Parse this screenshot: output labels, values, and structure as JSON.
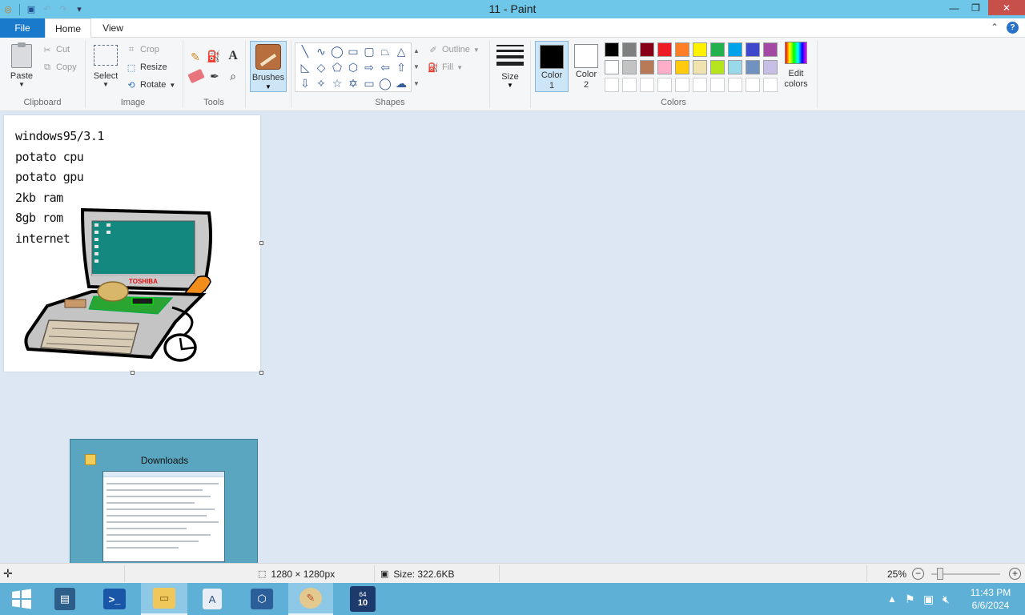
{
  "window": {
    "title": "11 - Paint",
    "controls": {
      "minimize": "—",
      "maximize": "❐",
      "close": "✕"
    }
  },
  "tabs": {
    "file": "File",
    "home": "Home",
    "view": "View"
  },
  "ribbon": {
    "clipboard": {
      "paste": "Paste",
      "cut": "Cut",
      "copy": "Copy",
      "label": "Clipboard"
    },
    "image": {
      "select": "Select",
      "crop": "Crop",
      "resize": "Resize",
      "rotate": "Rotate",
      "label": "Image"
    },
    "tools": {
      "label": "Tools",
      "text_tool": "A"
    },
    "brushes": "Brushes",
    "shapes": {
      "outline": "Outline",
      "fill": "Fill",
      "label": "Shapes"
    },
    "size": "Size",
    "color1": {
      "label_line1": "Color",
      "label_line2": "1",
      "value": "#000000"
    },
    "color2": {
      "label_line1": "Color",
      "label_line2": "2",
      "value": "#ffffff"
    },
    "colors_label": "Colors",
    "edit_colors_line1": "Edit",
    "edit_colors_line2": "colors",
    "palette": [
      "#000000",
      "#7f7f7f",
      "#880015",
      "#ed1c24",
      "#ff7f27",
      "#fff200",
      "#22b14c",
      "#00a2e8",
      "#3f48cc",
      "#a349a4",
      "#ffffff",
      "#c3c3c3",
      "#b97a57",
      "#ffaec9",
      "#ffc90e",
      "#efe4b0",
      "#b5e61d",
      "#99d9ea",
      "#7092be",
      "#c8bfe7",
      "#ffffff",
      "#ffffff",
      "#ffffff",
      "#ffffff",
      "#ffffff",
      "#ffffff",
      "#ffffff",
      "#ffffff",
      "#ffffff",
      "#ffffff"
    ]
  },
  "canvas": {
    "lines": [
      "windows95/3.1",
      "potato cpu",
      "potato gpu",
      "2kb ram",
      "8gb rom",
      "internet"
    ],
    "brand_text": "TOSHIBA"
  },
  "preview": {
    "title": "Downloads"
  },
  "statusbar": {
    "dimensions": "1280 × 1280px",
    "size": "Size: 322.6KB",
    "zoom": "25%",
    "zoom_out": "−",
    "zoom_in": "+"
  },
  "taskbar": {
    "time": "11:43 PM",
    "date": "6/6/2024",
    "badge": "10",
    "badge_top": "64"
  }
}
